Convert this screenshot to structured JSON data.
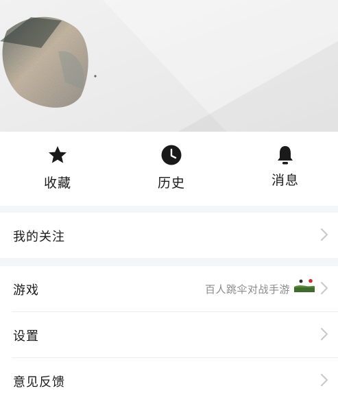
{
  "quick_actions": [
    {
      "label": "收藏",
      "icon": "star-icon"
    },
    {
      "label": "历史",
      "icon": "clock-icon"
    },
    {
      "label": "消息",
      "icon": "bell-icon"
    }
  ],
  "menu": {
    "following": {
      "label": "我的关注"
    },
    "games": {
      "label": "游戏",
      "promo": "百人跳伞对战手游"
    },
    "settings": {
      "label": "设置"
    },
    "feedback": {
      "label": "意见反馈"
    }
  },
  "colors": {
    "icon": "#1a1a1a",
    "text": "#1a1a1a",
    "muted": "#8a8a8a",
    "chevron": "#c8c8c8",
    "separator": "#f4f5f7"
  }
}
